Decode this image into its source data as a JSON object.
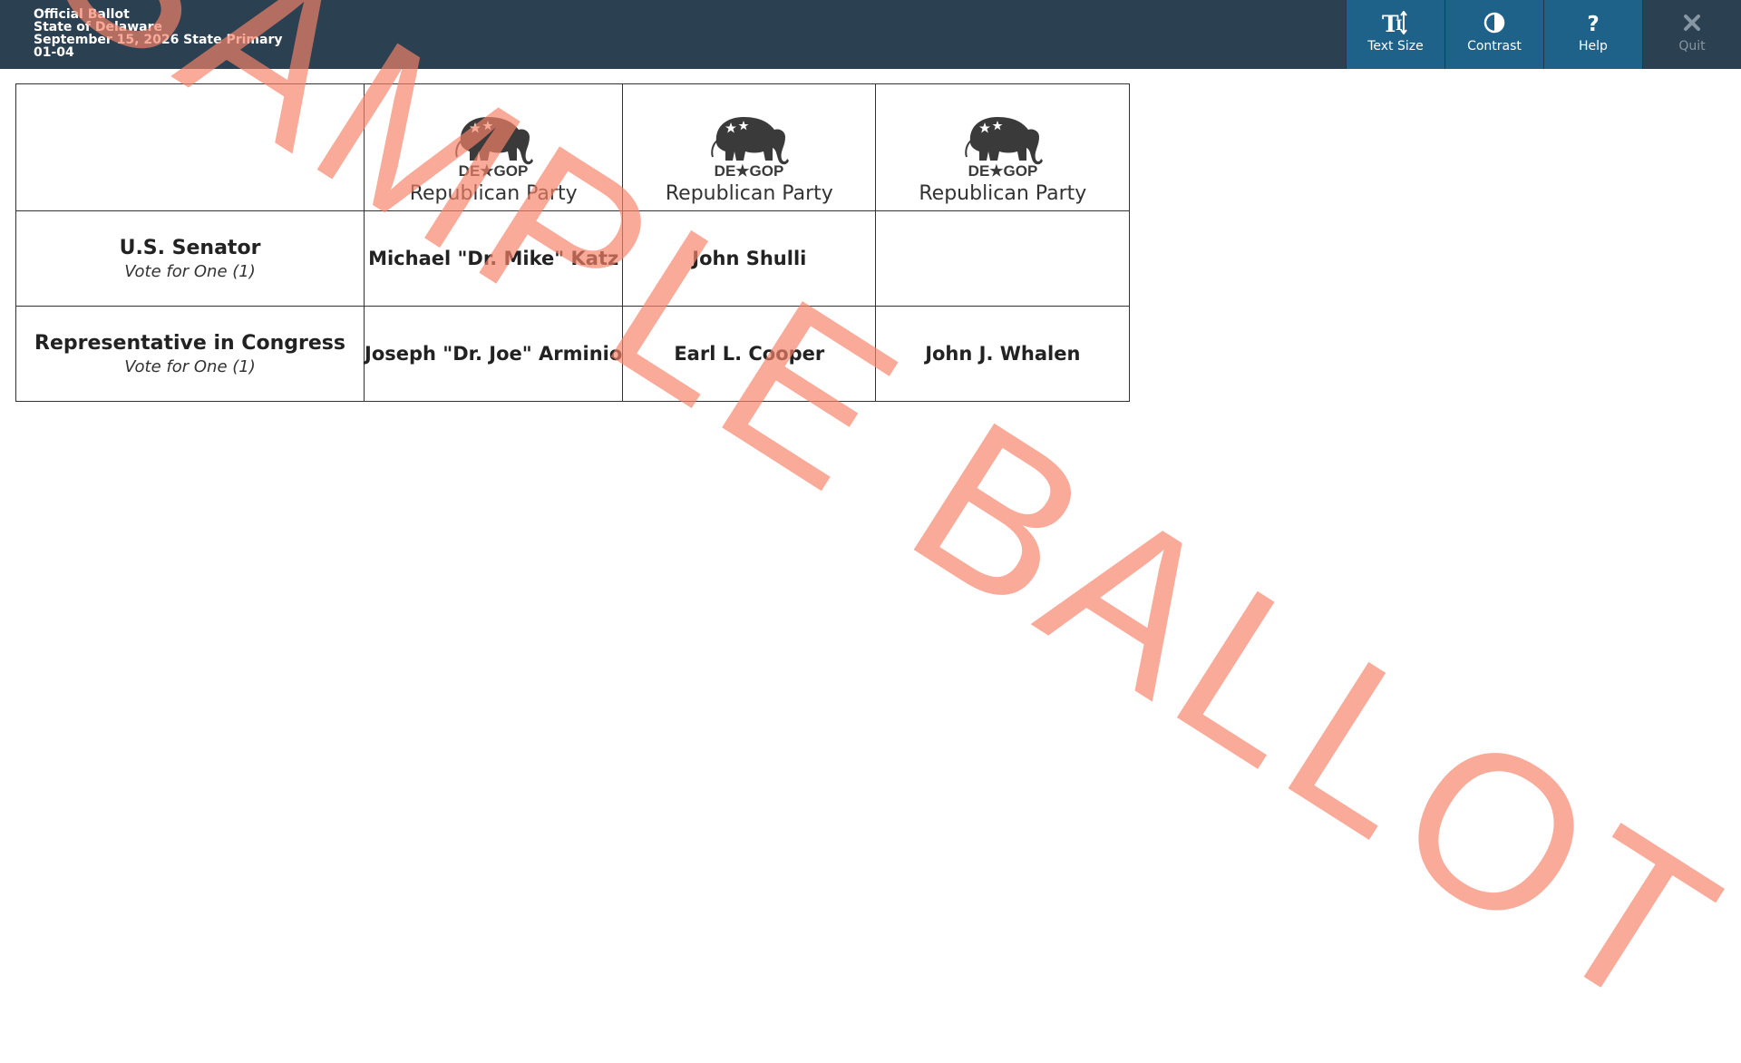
{
  "header": {
    "line1": "Official Ballot",
    "line2": "State of Delaware",
    "line3": "September 15, 2026 State Primary",
    "line4": "01-04"
  },
  "toolbar": {
    "text_size": "Text Size",
    "contrast": "Contrast",
    "help": "Help",
    "quit": "Quit",
    "colors": {
      "header_bg": "#2b4152",
      "button_bg": "#1f6289"
    }
  },
  "party_logo_text": "DE★GOP",
  "parties": [
    {
      "name": "Republican Party"
    },
    {
      "name": "Republican Party"
    },
    {
      "name": "Republican Party"
    }
  ],
  "contests": [
    {
      "office": "U.S. Senator",
      "vote_for": "Vote for One (1)",
      "candidates": [
        "Michael \"Dr. Mike\" Katz",
        "John Shulli",
        ""
      ]
    },
    {
      "office": "Representative in Congress",
      "vote_for": "Vote for One (1)",
      "candidates": [
        "Joseph \"Dr. Joe\" Arminio",
        "Earl L. Cooper",
        "John J. Whalen"
      ]
    }
  ],
  "watermark": "SAMPLE BALLOT",
  "watermark_color": "#f68268"
}
